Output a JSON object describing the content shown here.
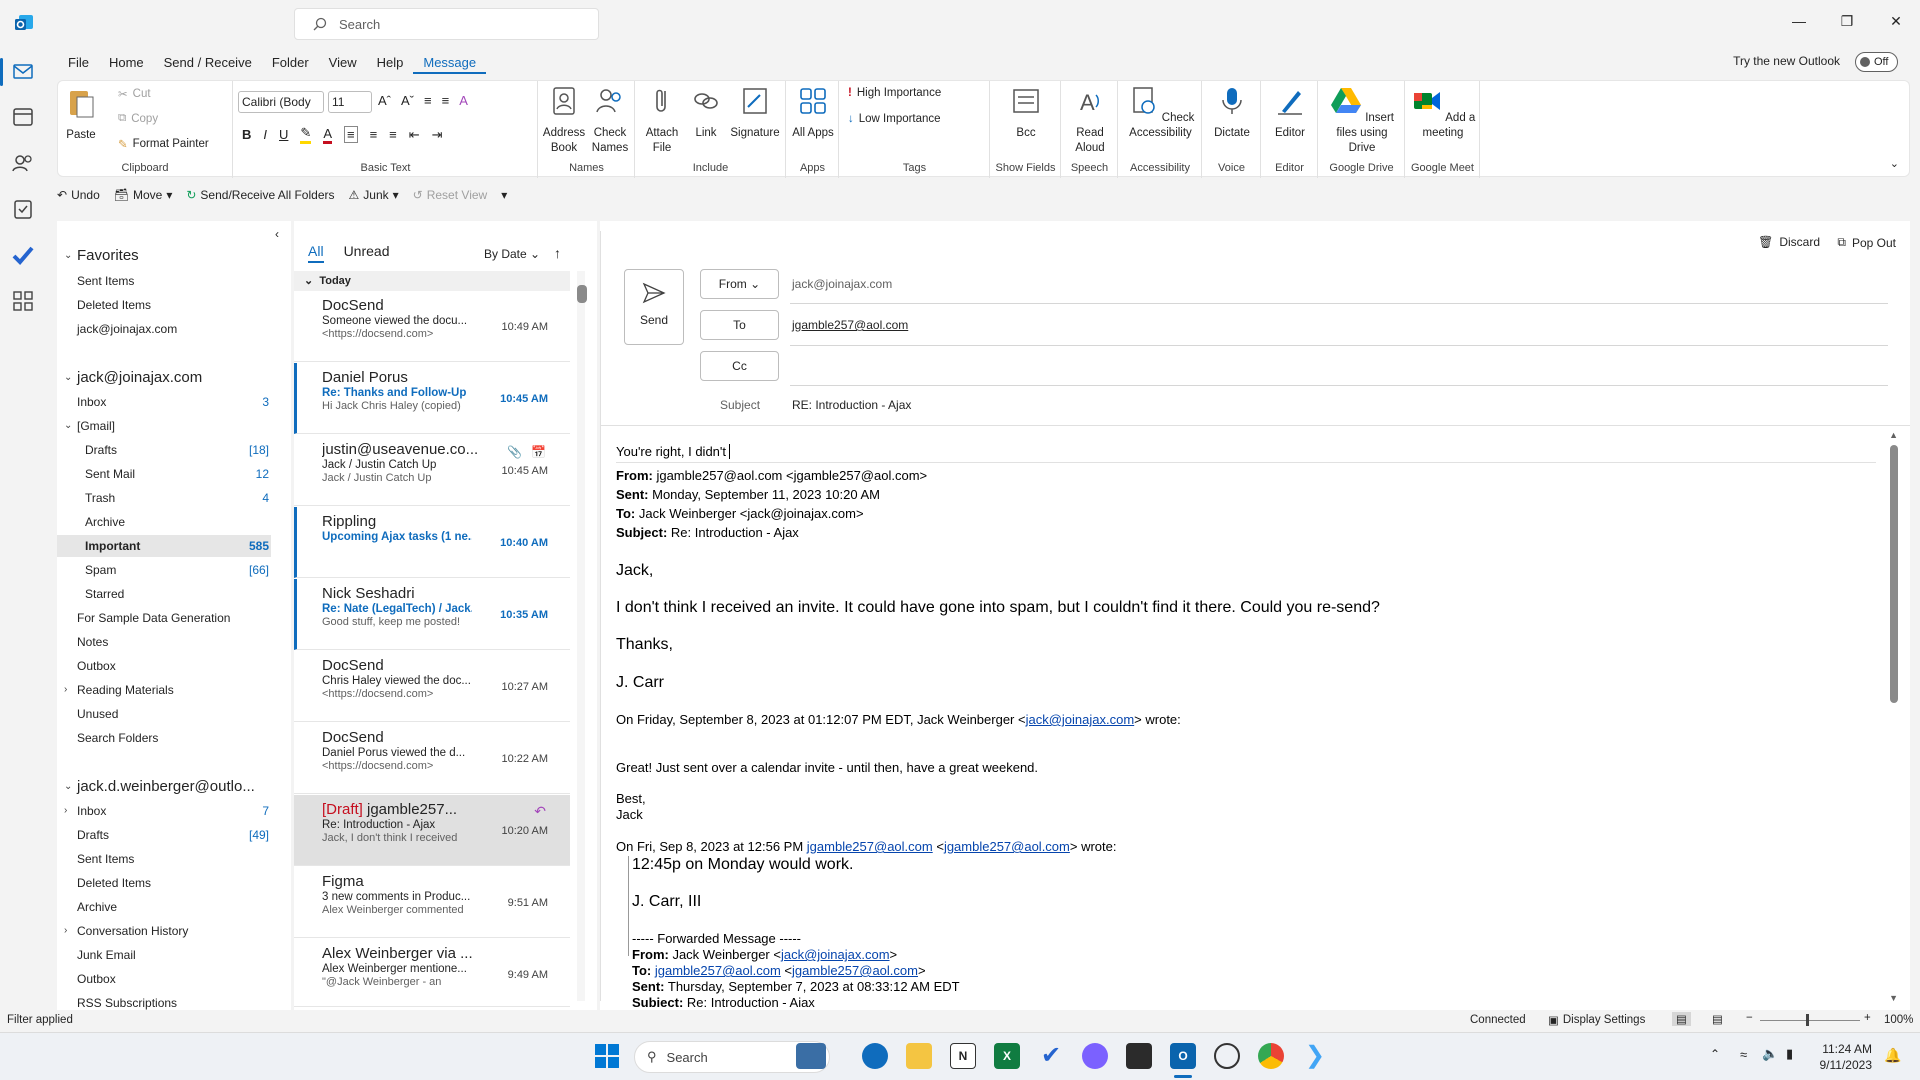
{
  "titlebar": {
    "search_placeholder": "Search"
  },
  "menu": [
    "File",
    "Home",
    "Send / Receive",
    "Folder",
    "View",
    "Help",
    "Message"
  ],
  "try_new": {
    "label": "Try the new Outlook",
    "toggle": "Off"
  },
  "ribbon": {
    "clipboard": {
      "paste": "Paste",
      "cut": "Cut",
      "copy": "Copy",
      "format_painter": "Format Painter",
      "group": "Clipboard"
    },
    "basic_text": {
      "font": "Calibri (Body",
      "size": "11",
      "group": "Basic Text"
    },
    "names": {
      "address_book": "Address Book",
      "check_names": "Check Names",
      "group": "Names"
    },
    "include": {
      "attach_file": "Attach File",
      "link": "Link",
      "signature": "Signature",
      "group": "Include"
    },
    "apps": {
      "all_apps": "All Apps",
      "group": "Apps"
    },
    "tags": {
      "high": "High Importance",
      "low": "Low Importance",
      "group": "Tags"
    },
    "show_fields": {
      "bcc": "Bcc",
      "group": "Show Fields"
    },
    "speech": {
      "read_aloud": "Read Aloud",
      "group": "Speech"
    },
    "accessibility": {
      "check": "Check Accessibility",
      "group": "Accessibility"
    },
    "voice": {
      "dictate": "Dictate",
      "group": "Voice"
    },
    "editor": {
      "editor": "Editor",
      "group": "Editor"
    },
    "google_drive": {
      "insert": "Insert files using Drive",
      "group": "Google Drive"
    },
    "google_meet": {
      "add": "Add a meeting",
      "group": "Google Meet"
    }
  },
  "qat": {
    "undo": "Undo",
    "move": "Move",
    "send_receive": "Send/Receive All Folders",
    "junk": "Junk",
    "reset": "Reset View"
  },
  "nav": {
    "favorites": "Favorites",
    "fav_items": [
      "Sent Items",
      "Deleted Items",
      "jack@joinajax.com"
    ],
    "account1": "jack@joinajax.com",
    "inbox": {
      "label": "Inbox",
      "count": "3"
    },
    "gmail": "[Gmail]",
    "gmail_items": [
      {
        "label": "Drafts",
        "count": "[18]"
      },
      {
        "label": "Sent Mail",
        "count": "12"
      },
      {
        "label": "Trash",
        "count": "4"
      },
      {
        "label": "Archive",
        "count": ""
      },
      {
        "label": "Important",
        "count": "585"
      },
      {
        "label": "Spam",
        "count": "[66]"
      },
      {
        "label": "Starred",
        "count": ""
      }
    ],
    "other1": [
      "For Sample Data Generation",
      "Notes",
      "Outbox",
      "Reading Materials",
      "Unused",
      "Search Folders"
    ],
    "account2": "jack.d.weinberger@outlo...",
    "account2_items": [
      {
        "label": "Inbox",
        "count": "7"
      },
      {
        "label": "Drafts",
        "count": "[49]"
      },
      {
        "label": "Sent Items",
        "count": ""
      },
      {
        "label": "Deleted Items",
        "count": ""
      },
      {
        "label": "Archive",
        "count": ""
      },
      {
        "label": "Conversation History",
        "count": ""
      },
      {
        "label": "Junk Email",
        "count": ""
      },
      {
        "label": "Outbox",
        "count": ""
      },
      {
        "label": "RSS Subscriptions",
        "count": ""
      }
    ]
  },
  "list": {
    "tab_all": "All",
    "tab_unread": "Unread",
    "sort": "By Date",
    "group": "Today",
    "messages": [
      {
        "sender": "DocSend",
        "subject": "Someone viewed the docu...",
        "preview": "<https://docsend.com>",
        "time": "10:49 AM"
      },
      {
        "sender": "Daniel Porus",
        "subject": "Re: Thanks and Follow-Up",
        "preview": "Hi Jack  Chris Haley (copied)",
        "time": "10:45 AM"
      },
      {
        "sender": "justin@useavenue.co...",
        "subject": "Jack / Justin Catch Up",
        "preview": "Jack / Justin Catch Up",
        "time": "10:45 AM"
      },
      {
        "sender": "Rippling",
        "subject": "Upcoming Ajax tasks (1 ne...",
        "preview": "",
        "time": "10:40 AM"
      },
      {
        "sender": "Nick Seshadri",
        "subject": "Re: Nate (LegalTech) / Jack...",
        "preview": "Good stuff, keep me posted!",
        "time": "10:35 AM"
      },
      {
        "sender": "DocSend",
        "subject": "Chris Haley viewed the doc...",
        "preview": "<https://docsend.com>",
        "time": "10:27 AM"
      },
      {
        "sender": "DocSend",
        "subject": "Daniel Porus viewed the d...",
        "preview": "<https://docsend.com>",
        "time": "10:22 AM"
      },
      {
        "draft": "[Draft]",
        "sender": " jgamble257...",
        "subject": "Re: Introduction - Ajax",
        "preview": "Jack,  I don't think I received",
        "time": "10:20 AM"
      },
      {
        "sender": "Figma",
        "subject": "3 new comments in Produc...",
        "preview": "Alex Weinberger commented",
        "time": "9:51 AM"
      },
      {
        "sender": "Alex Weinberger via ...",
        "subject": "Alex Weinberger mentione...",
        "preview": "\"@Jack Weinberger - an",
        "time": "9:49 AM"
      }
    ]
  },
  "compose": {
    "discard": "Discard",
    "popout": "Pop Out",
    "send": "Send",
    "from_btn": "From",
    "to_btn": "To",
    "cc_btn": "Cc",
    "from_value": "jack@joinajax.com",
    "to_value": "jgamble257@aol.com",
    "subject_label": "Subject",
    "subject_value": "RE: Introduction - Ajax",
    "typed": "You're right, I didn't",
    "hdr_from_l": "From:",
    "hdr_from": " jgamble257@aol.com <jgamble257@aol.com>",
    "hdr_sent_l": "Sent:",
    "hdr_sent": " Monday, September 11, 2023 10:20 AM",
    "hdr_to_l": "To:",
    "hdr_to": " Jack Weinberger <jack@joinajax.com>",
    "hdr_subj_l": "Subject:",
    "hdr_subj": " Re: Introduction - Ajax",
    "b1": "Jack,",
    "b2": "I don't think I received an invite.  It could have gone into spam, but I couldn't find it there.  Could you re-send?",
    "b3": "Thanks,",
    "b4": "J. Carr",
    "q1a": "On Friday, September 8, 2023 at 01:12:07 PM EDT, Jack Weinberger <",
    "q1link": "jack@joinajax.com",
    "q1b": "> wrote:",
    "q2": "Great! Just sent over a calendar invite - until then, have a great weekend.",
    "q3": "Best,",
    "q4": "Jack",
    "q5a": "On Fri, Sep 8, 2023 at 12:56 PM ",
    "q5link1": "jgamble257@aol.com",
    "q5b": " <",
    "q5link2": "jgamble257@aol.com",
    "q5c": "> wrote:",
    "q6": "12:45p on Monday would work.",
    "q7": "J. Carr, III",
    "q8": "----- Forwarded Message -----",
    "q9l": "From:",
    "q9": " Jack Weinberger <",
    "q9link": "jack@joinajax.com",
    "q9b": ">",
    "q10l": "To:",
    "q10link1": "jgamble257@aol.com",
    "q10b": " <",
    "q10link2": "jgamble257@aol.com",
    "q10c": ">",
    "q11l": "Sent:",
    "q11": " Thursday, September 7, 2023 at 08:33:12 AM EDT",
    "q12l": "Subject:",
    "q12": " Re: Introduction - Ajax"
  },
  "status": {
    "filter": "Filter applied",
    "connected": "Connected",
    "display": "Display Settings",
    "zoom": "100%"
  },
  "taskbar": {
    "search": "Search",
    "time": "11:24 AM",
    "date": "9/11/2023"
  },
  "colors": {
    "accent": "#0f6cbd",
    "draft": "#c50f1f"
  }
}
